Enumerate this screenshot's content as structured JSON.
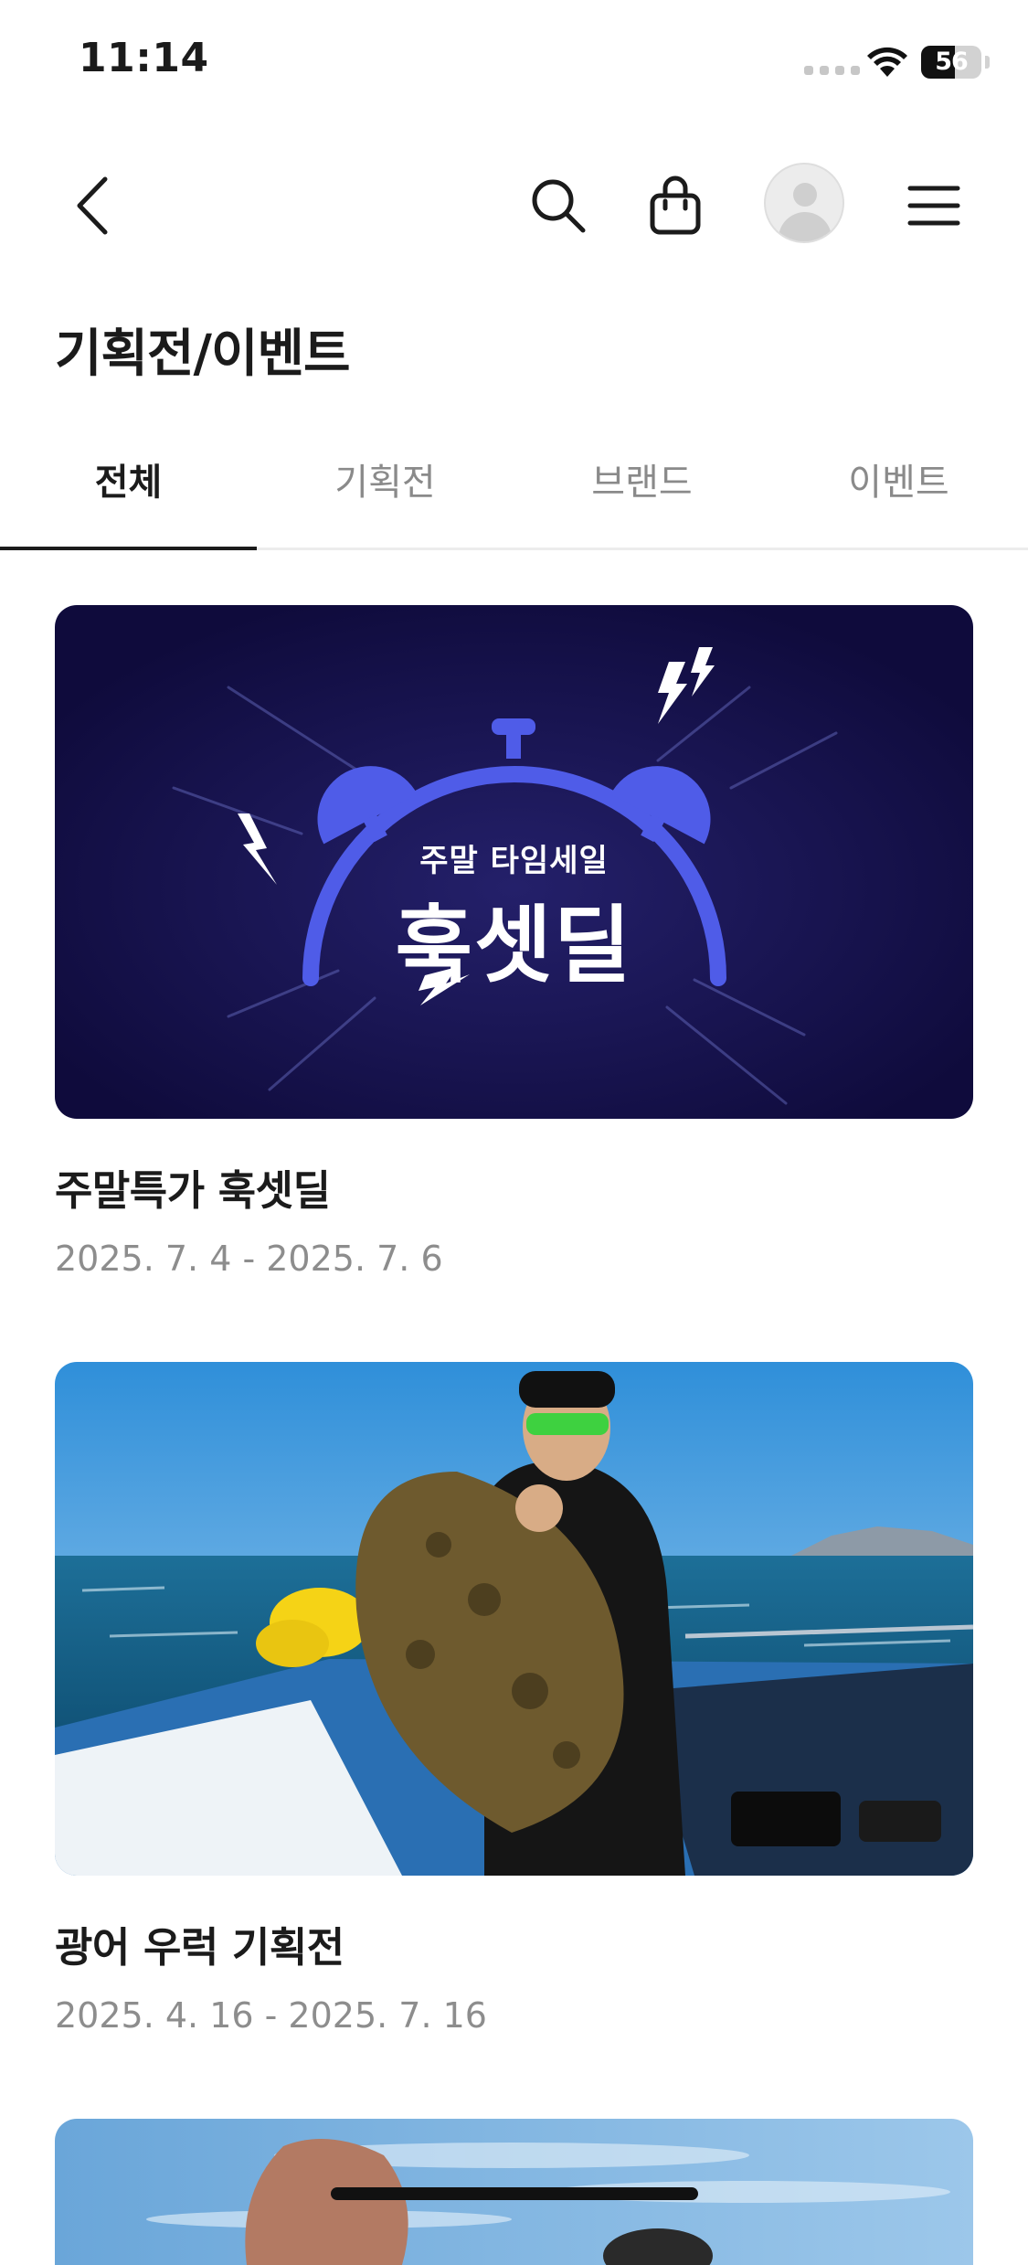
{
  "status_bar": {
    "time": "11:14",
    "battery_level": "56"
  },
  "header": {
    "back_icon": "chevron-left-icon",
    "search_icon": "search-icon",
    "cart_icon": "shopping-bag-icon",
    "avatar": "user-avatar",
    "menu_icon": "hamburger-menu-icon"
  },
  "page": {
    "title": "기획전/이벤트"
  },
  "tabs": [
    {
      "label": "전체",
      "active": true
    },
    {
      "label": "기획전",
      "active": false
    },
    {
      "label": "브랜드",
      "active": false
    },
    {
      "label": "이벤트",
      "active": false
    }
  ],
  "cards": [
    {
      "title": "주말특가 훅셋딜",
      "date": "2025. 7. 4 - 2025. 7. 6",
      "banner_subtitle": "주말 타임세일",
      "banner_title": "훅셋딜"
    },
    {
      "title": "광어 우럭 기획전",
      "date": "2025. 4. 16 - 2025. 7. 16"
    }
  ],
  "colors": {
    "banner_bg": "#120d45",
    "alarm_blue": "#4f5ce8",
    "tab_active": "#1b1b1b",
    "tab_inactive": "#8a8a8a",
    "date_gray": "#8d8d8d"
  }
}
